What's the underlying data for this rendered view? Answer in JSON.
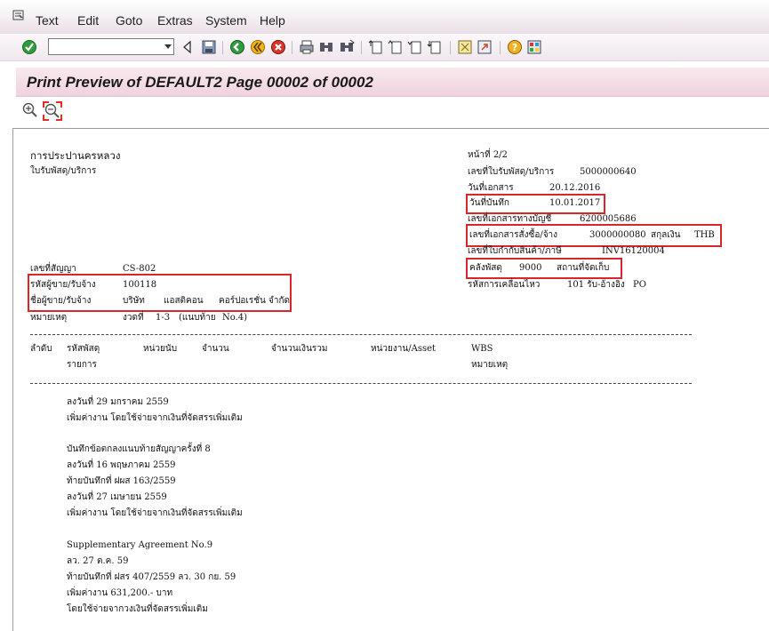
{
  "menu": {
    "items": [
      "Text",
      "Edit",
      "Goto",
      "Extras",
      "System",
      "Help"
    ]
  },
  "title_bar": {
    "title": "Print Preview of DEFAULT2 Page 00002 of 00002"
  },
  "colors": {
    "highlight": "#d9262b",
    "title_bg": "#efd2dd"
  },
  "document": {
    "org_name": "การประปานครหลวง",
    "doc_type": "ใบรับพัสดุ/บริการ",
    "page_label": "หน้าที่ 2/2",
    "receipt_no_label": "เลขที่ใบรับพัสดุ/บริการ",
    "receipt_no_value": "5000000640",
    "doc_date_label": "วันที่เอกสาร",
    "doc_date_value": "20.12.2016",
    "record_date_label": "วันที่บันทึก",
    "record_date_value": "10.01.2017",
    "acct_doc_label": "เลขที่เอกสารทางบัญชี",
    "acct_doc_value": "6200005686",
    "po_label": "เลขที่เอกสารสั่งซื้อ/จ้าง",
    "po_value": "3000000080",
    "currency_label": "สกุลเงิน",
    "currency_value": "THB",
    "invoice_label": "เลขที่ใบกำกับสินค้า/ภาษี",
    "invoice_value": "INV16120004",
    "warehouse_label": "คลังพัสดุ",
    "warehouse_value": "9000",
    "storage_label": "สถานที่จัดเก็บ",
    "movement_label": "รหัสการเคลื่อนไหว",
    "movement_value": "101 รับ-อ้างอิง",
    "movement_suffix": "PO",
    "contract_label": "เลขที่สัญญา",
    "contract_value": "CS-802",
    "vendor_code_label": "รหัสผู้ขาย/รับจ้าง",
    "vendor_code_value": "100118",
    "vendor_name_label": "ชื่อผู้ขาย/รับจ้าง",
    "vendor_name_1": "บริษัท",
    "vendor_name_2": "แอสติคอน",
    "vendor_name_3": "คอร์ปอเรชั่น จำกัด",
    "note_label": "หมายเหตุ",
    "note_value_1": "งวดที่",
    "note_value_2": "1-3",
    "note_value_3": "(แนบท้าย",
    "note_value_4": "No.4)"
  },
  "table_header": {
    "col_seq": "ลำดับ",
    "col_code": "รหัสพัสดุ",
    "col_unit": "หน่วยนับ",
    "col_qty": "จำนวน",
    "col_amount": "จำนวนเงินรวม",
    "col_dept": "หน่วยงาน/Asset",
    "col_wbs": "WBS",
    "col_items": "รายการ",
    "col_remark": "หมายเหตุ"
  },
  "remarks": {
    "lines": [
      "ลงวันที่  29  มกราคม  2559",
      "เพิ่มค่างาน โดยใช้จ่ายจากเงินที่จัดสรรเพิ่มเติม",
      "บันทึกข้อตกลงแนบท้ายสัญญาครั้งที่  8",
      "ลงวันที่   16   พฤษภาคม   2559",
      "ท้ายบันทึกที่    ฝผส    163/2559",
      "ลงวันที่   27   เมษายน   2559",
      "เพิ่มค่างาน โดยใช้จ่ายจากเงินที่จัดสรรเพิ่มเติม",
      "Supplementary     Agreement     No.9",
      "ลว.  27  ต.ค.  59",
      "ท้ายบันทึกที่    ฝสร   407/2559   ลว. 30  กย.  59",
      "เพิ่มค่างาน    631,200.-    บาท",
      "โดยใช้จ่ายจากวงเงินที่จัดสรรเพิ่มเติม"
    ]
  }
}
